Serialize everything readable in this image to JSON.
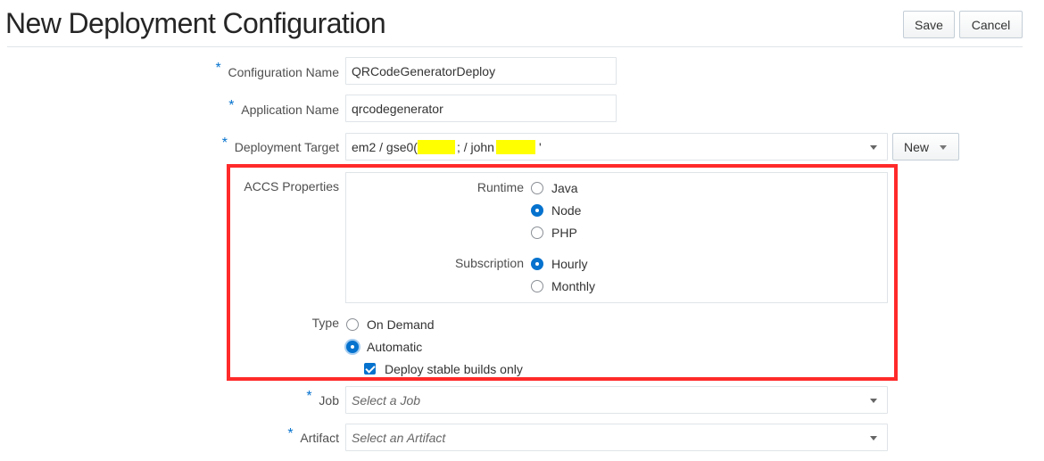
{
  "page": {
    "title": "New Deployment Configuration"
  },
  "toolbar": {
    "save_label": "Save",
    "cancel_label": "Cancel"
  },
  "form": {
    "required_marker": "*",
    "configuration_name": {
      "label": "Configuration Name",
      "value": "QRCodeGeneratorDeploy"
    },
    "application_name": {
      "label": "Application Name",
      "value": "qrcodegenerator"
    },
    "deployment_target": {
      "label": "Deployment Target",
      "value_part1": "em2 / gse0(",
      "value_part2": "; / john",
      "value_part3": "'",
      "new_label": "New"
    },
    "accs": {
      "label": "ACCS Properties",
      "runtime": {
        "label": "Runtime",
        "options": [
          "Java",
          "Node",
          "PHP"
        ],
        "selected": "Node"
      },
      "subscription": {
        "label": "Subscription",
        "options": [
          "Hourly",
          "Monthly"
        ],
        "selected": "Hourly"
      }
    },
    "type": {
      "label": "Type",
      "options": [
        "On Demand",
        "Automatic"
      ],
      "selected": "Automatic",
      "deploy_stable_label": "Deploy stable builds only",
      "deploy_stable_checked": true
    },
    "job": {
      "label": "Job",
      "placeholder": "Select a Job"
    },
    "artifact": {
      "label": "Artifact",
      "placeholder": "Select an Artifact"
    }
  },
  "colors": {
    "accent": "#0572ce",
    "highlight_border": "#ff2a2a",
    "redaction": "#ffff00"
  }
}
